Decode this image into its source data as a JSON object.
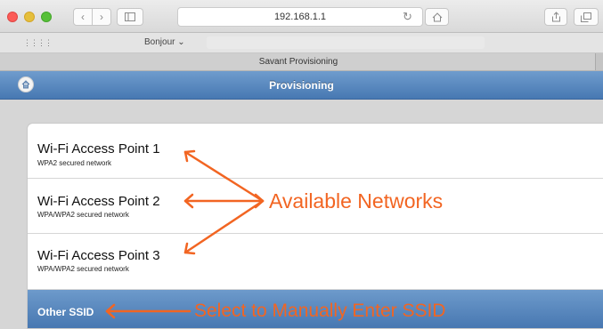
{
  "browser": {
    "address": "192.168.1.1",
    "reload_icon": "reload-icon",
    "bookmarks_label": "Bonjour ⌄",
    "tab_title": "Savant Provisioning"
  },
  "app": {
    "title": "Provisioning",
    "header_color": "#4f80b9"
  },
  "networks": [
    {
      "name": "Wi-Fi Access Point 1",
      "security": "WPA2 secured network"
    },
    {
      "name": "Wi-Fi Access Point 2",
      "security": "WPA/WPA2 secured network"
    },
    {
      "name": "Wi-Fi Access Point 3",
      "security": "WPA/WPA2 secured network"
    }
  ],
  "other_ssid": {
    "label": "Other SSID"
  },
  "annotations": {
    "available_networks": "Available Networks",
    "select_manual": "Select to Manually Enter SSID",
    "color": "#f26522"
  }
}
